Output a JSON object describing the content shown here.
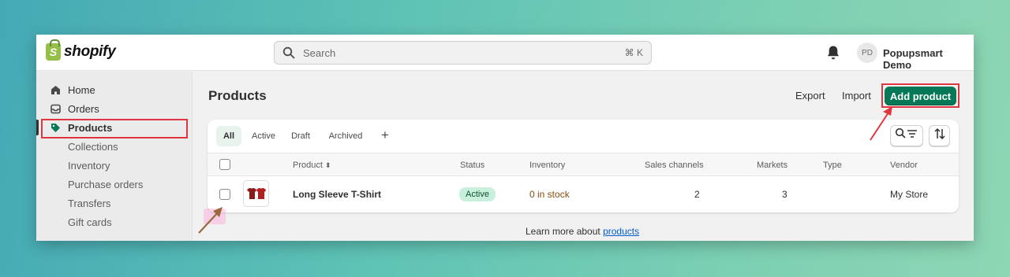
{
  "app": {
    "brand": "shopify",
    "brand_color": "#95bf47",
    "accent_color": "#047857"
  },
  "topbar": {
    "search_placeholder": "Search",
    "search_shortcut": "⌘ K",
    "avatar_initials": "PD",
    "store_name": "Popupsmart Demo"
  },
  "sidebar": {
    "items": [
      {
        "label": "Home",
        "icon": "home-icon"
      },
      {
        "label": "Orders",
        "icon": "inbox-icon"
      },
      {
        "label": "Products",
        "icon": "tag-icon",
        "active": true
      }
    ],
    "sub_items": [
      "Collections",
      "Inventory",
      "Purchase orders",
      "Transfers",
      "Gift cards"
    ]
  },
  "page": {
    "title": "Products",
    "export_label": "Export",
    "import_label": "Import",
    "add_product_label": "Add product"
  },
  "tabs": [
    {
      "label": "All",
      "active": true
    },
    {
      "label": "Active"
    },
    {
      "label": "Draft"
    },
    {
      "label": "Archived"
    }
  ],
  "table": {
    "columns": [
      "Product",
      "Status",
      "Inventory",
      "Sales channels",
      "Markets",
      "Type",
      "Vendor"
    ],
    "rows": [
      {
        "product": "Long Sleeve T-Shirt",
        "status": "Active",
        "inventory": "0 in stock",
        "sales_channels": "2",
        "markets": "3",
        "type": "",
        "vendor": "My Store"
      }
    ]
  },
  "footer": {
    "text": "Learn more about ",
    "link": "products"
  }
}
